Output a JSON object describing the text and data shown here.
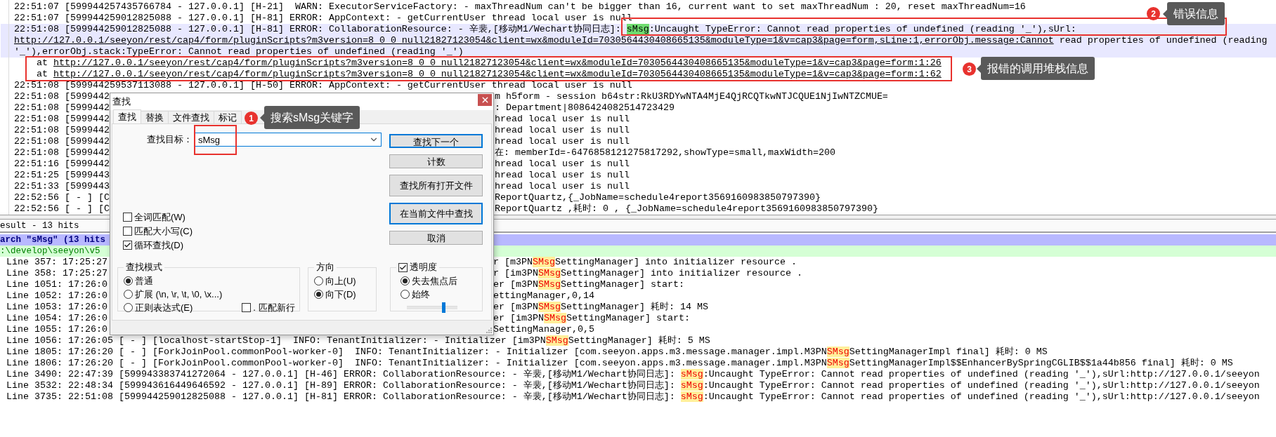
{
  "log": {
    "lines": [
      {
        "current": false,
        "left": [
          {
            "kind": "text",
            "text": "22:51:07 [599944257435766784 - 127.0.0.1] [H-21]  WARN: ExecutorServiceFactory: - maxThreadNum can't be bigger than 16, current want to set maxThreadNum : 20, reset maxThreadNum=16"
          }
        ]
      },
      {
        "current": false,
        "left": [
          {
            "kind": "text",
            "text": "22:51:07 [599944259012825088 - 127.0.0.1] [H-81] ERROR: AppContext: - getCurrentUser thread local user is null"
          }
        ]
      },
      {
        "current": true,
        "left": [
          {
            "kind": "text",
            "text": "22:51:08 [599944259012825088 - 127.0.0.1] [H-81] ERROR: CollaborationResource: - 辛裴,[移动M1/Wechart协同日志]: "
          },
          {
            "kind": "mark",
            "text": "sMsg"
          },
          {
            "kind": "text",
            "text": ":Uncaught TypeError: Cannot read properties of undefined (reading '_'),sUrl:"
          }
        ]
      },
      {
        "current": true,
        "left": [
          {
            "kind": "link",
            "text": "http://127.0.0.1/seeyon/rest/cap4/form/pluginScripts?m3version=8_0_0_null21827123054&client=wx&moduleId=7030564430408665135&moduleType=1&v=cap3&page=form,sLine:1,errorObj.message:Cannot"
          },
          {
            "kind": "text",
            "text": " read properties of undefined (reading"
          }
        ]
      },
      {
        "current": true,
        "left": [
          {
            "kind": "text",
            "text": "'_'),errorObj.stack:TypeError: Cannot read properties of undefined (reading '_')"
          }
        ]
      },
      {
        "current": false,
        "left": [
          {
            "kind": "text",
            "text": "    at "
          },
          {
            "kind": "link",
            "text": "http://127.0.0.1/seeyon/rest/cap4/form/pluginScripts?m3version=8_0_0_null21827123054&client=wx&moduleId=7030564430408665135&moduleType=1&v=cap3&page=form:1:26"
          }
        ]
      },
      {
        "current": false,
        "left": [
          {
            "kind": "text",
            "text": "    at "
          },
          {
            "kind": "link",
            "text": "http://127.0.0.1/seeyon/rest/cap4/form/pluginScripts?m3version=8_0_0_null21827123054&client=wx&moduleId=7030564430408665135&moduleType=1&v=cap3&page=form:1:62"
          }
        ]
      },
      {
        "current": false,
        "left": [
          {
            "kind": "text",
            "text": "22:51:08 [599944259537113088 - 127.0.0.1] [H-50] ERROR: AppContext: - getCurrentUser thread local user is null"
          }
        ]
      },
      {
        "current": false,
        "left": [
          {
            "kind": "text",
            "text": "22:51:08 [5999442"
          }
        ],
        "right": [
          {
            "kind": "text",
            "text": "m h5form - session b64str:RkU3RDYwNTA4MjE4QjRCQTkwNTJCQUE1NjIwNTZCMUE="
          }
        ]
      },
      {
        "current": false,
        "left": [
          {
            "kind": "text",
            "text": "22:51:08 [5999442"
          }
        ],
        "right": [
          {
            "kind": "text",
            "text": ": Department|8086424082514723429"
          }
        ]
      },
      {
        "current": false,
        "left": [
          {
            "kind": "text",
            "text": "22:51:08 [5999442"
          }
        ],
        "right": [
          {
            "kind": "text",
            "text": "hread local user is null"
          }
        ]
      },
      {
        "current": false,
        "left": [
          {
            "kind": "text",
            "text": "22:51:08 [5999442"
          }
        ],
        "right": [
          {
            "kind": "text",
            "text": "hread local user is null"
          }
        ]
      },
      {
        "current": false,
        "left": [
          {
            "kind": "text",
            "text": "22:51:08 [5999442"
          }
        ],
        "right": [
          {
            "kind": "text",
            "text": "hread local user is null"
          }
        ]
      },
      {
        "current": false,
        "left": [
          {
            "kind": "text",
            "text": "22:51:08 [5999442"
          }
        ],
        "right": [
          {
            "kind": "text",
            "text": "在: memberId=-6476858121275817292,showType=small,maxWidth=200"
          }
        ]
      },
      {
        "current": false,
        "left": [
          {
            "kind": "text",
            "text": "22:51:16 [5999442"
          }
        ],
        "right": [
          {
            "kind": "text",
            "text": "hread local user is null"
          }
        ]
      },
      {
        "current": false,
        "left": [
          {
            "kind": "text",
            "text": "22:51:25 [5999443"
          }
        ],
        "right": [
          {
            "kind": "text",
            "text": "hread local user is null"
          }
        ]
      },
      {
        "current": false,
        "left": [
          {
            "kind": "text",
            "text": "22:51:33 [5999443"
          }
        ],
        "right": [
          {
            "kind": "text",
            "text": "hread local user is null"
          }
        ]
      },
      {
        "current": false,
        "left": [
          {
            "kind": "text",
            "text": "22:52:56 [ - ] [C"
          }
        ],
        "right": [
          {
            "kind": "text",
            "text": "ReportQuartz,{_JobName=schedule4report3569160983850797390}"
          }
        ]
      },
      {
        "current": false,
        "left": [
          {
            "kind": "text",
            "text": "22:52:56 [ - ] [C"
          }
        ],
        "right": [
          {
            "kind": "text",
            "text": "ReportQuartz ,耗时: 0 , {_JobName=schedule4report3569160983850797390}"
          }
        ]
      }
    ]
  },
  "results": {
    "title": "esult - 13 hits",
    "search": "arch \"sMsg\" (13 hits",
    "file": ":\\develop\\seeyon\\v5",
    "lines": [
      {
        "left": [
          {
            "kind": "text",
            "text": "Line 357: 17:25:27"
          }
        ],
        "right": [
          {
            "kind": "text",
            "text": "r [m3PN"
          },
          {
            "kind": "hit",
            "text": "SMsg"
          },
          {
            "kind": "text",
            "text": "SettingManager] into initializer resource ."
          }
        ]
      },
      {
        "left": [
          {
            "kind": "text",
            "text": "Line 358: 17:25:27"
          }
        ],
        "right": [
          {
            "kind": "text",
            "text": "r [im3PN"
          },
          {
            "kind": "hit",
            "text": "SMsg"
          },
          {
            "kind": "text",
            "text": "SettingManager] into initializer resource ."
          }
        ]
      },
      {
        "left": [
          {
            "kind": "text",
            "text": "Line 1051: 17:26:0"
          }
        ],
        "right": [
          {
            "kind": "text",
            "text": "er [m3PN"
          },
          {
            "kind": "hit",
            "text": "SMsg"
          },
          {
            "kind": "text",
            "text": "SettingManager] start:"
          }
        ]
      },
      {
        "left": [
          {
            "kind": "text",
            "text": "Line 1052: 17:26:0"
          }
        ],
        "right": [
          {
            "kind": "text",
            "text": "ettingManager,0,14"
          }
        ]
      },
      {
        "left": [
          {
            "kind": "text",
            "text": "Line 1053: 17:26:0"
          }
        ],
        "right": [
          {
            "kind": "text",
            "text": "er [m3PN"
          },
          {
            "kind": "hit",
            "text": "SMsg"
          },
          {
            "kind": "text",
            "text": "SettingManager] 耗时: 14 MS"
          }
        ]
      },
      {
        "left": [
          {
            "kind": "text",
            "text": "Line 1054: 17:26:0"
          }
        ],
        "right": [
          {
            "kind": "text",
            "text": "er [im3PN"
          },
          {
            "kind": "hit",
            "text": "SMsg"
          },
          {
            "kind": "text",
            "text": "SettingManager] start:"
          }
        ]
      },
      {
        "left": [
          {
            "kind": "text",
            "text": "Line 1055: 17:26:0"
          }
        ],
        "right": [
          {
            "kind": "text",
            "text": "SettingManager,0,5"
          }
        ]
      },
      {
        "left": [
          {
            "kind": "text",
            "text": "Line 1056: 17:26:05 [ - ] [localhost-startStop-1]  INFO: TenantInitializer: - Initializer [im3PN"
          },
          {
            "kind": "hit",
            "text": "SMsg"
          },
          {
            "kind": "text",
            "text": "SettingManager] 耗时: 5 MS"
          }
        ]
      },
      {
        "left": [
          {
            "kind": "text",
            "text": "Line 1805: 17:26:20 [ - ] [ForkJoinPool.commonPool-worker-0]  INFO: TenantInitializer: - Initializer [com.seeyon.apps.m3.message.manager.impl.M3PN"
          },
          {
            "kind": "hit",
            "text": "SMsg"
          },
          {
            "kind": "text",
            "text": "SettingManagerImpl final] 耗时: 0 MS"
          }
        ]
      },
      {
        "left": [
          {
            "kind": "text",
            "text": "Line 1806: 17:26:20 [ - ] [ForkJoinPool.commonPool-worker-0]  INFO: TenantInitializer: - Initializer [com.seeyon.apps.m3.message.manager.impl.M3PN"
          },
          {
            "kind": "hit",
            "text": "SMsg"
          },
          {
            "kind": "text",
            "text": "SettingManagerImpl$$EnhancerBySpringCGLIB$$1a44b856 final] 耗时: 0 MS"
          }
        ]
      },
      {
        "left": [
          {
            "kind": "text",
            "text": "Line 3490: 22:47:39 [599943383741272064 - 127.0.0.1] [H-46] ERROR: CollaborationResource: - 辛裴,[移动M1/Wechart协同日志]: "
          },
          {
            "kind": "hit",
            "text": "sMsg"
          },
          {
            "kind": "text",
            "text": ":Uncaught TypeError: Cannot read properties of undefined (reading '_'),sUrl:http://127.0.0.1/seeyon"
          }
        ]
      },
      {
        "left": [
          {
            "kind": "text",
            "text": "Line 3532: 22:48:34 [599943616449646592 - 127.0.0.1] [H-89] ERROR: CollaborationResource: - 辛裴,[移动M1/Wechart协同日志]: "
          },
          {
            "kind": "hit",
            "text": "sMsg"
          },
          {
            "kind": "text",
            "text": ":Uncaught TypeError: Cannot read properties of undefined (reading '_'),sUrl:http://127.0.0.1/seeyon"
          }
        ]
      },
      {
        "left": [
          {
            "kind": "text",
            "text": "Line 3735: 22:51:08 [599944259012825088 - 127.0.0.1] [H-81] ERROR: CollaborationResource: - 辛裴,[移动M1/Wechart协同日志]: "
          },
          {
            "kind": "hit",
            "text": "sMsg"
          },
          {
            "kind": "text",
            "text": ":Uncaught TypeError: Cannot read properties of undefined (reading '_'),sUrl:http://127.0.0.1/seeyon"
          }
        ]
      }
    ]
  },
  "dialog": {
    "title": "查找",
    "tabs": [
      {
        "label": "查找",
        "selected": true
      },
      {
        "label": "替换",
        "selected": false
      },
      {
        "label": "文件查找",
        "selected": false
      },
      {
        "label": "标记",
        "selected": false
      }
    ],
    "field_label": "查找目标：",
    "search_value": "sMsg",
    "buttons": [
      {
        "label": "查找下一个",
        "focused": true
      },
      {
        "label": "计数",
        "focused": false
      },
      {
        "label": "查找所有打开文件",
        "focused": false
      },
      {
        "label": "在当前文件中查找",
        "focused": true
      },
      {
        "label": "取消",
        "focused": false
      }
    ],
    "options": [
      {
        "label": "全词匹配(W)",
        "checked": false
      },
      {
        "label": "匹配大小写(C)",
        "checked": false
      },
      {
        "label": "循环查找(D)",
        "checked": true
      }
    ],
    "mode": {
      "title": "查找模式",
      "choices": [
        {
          "label": "普通",
          "selected": true
        },
        {
          "label": "扩展 (\\n, \\r, \\t, \\0, \\x...)",
          "selected": false
        },
        {
          "label": "正则表达式(E)",
          "selected": false
        }
      ],
      "newline": {
        "label": ". 匹配新行",
        "checked": false
      }
    },
    "direction": {
      "title": "方向",
      "choices": [
        {
          "label": "向上(U)",
          "selected": false
        },
        {
          "label": "向下(D)",
          "selected": true
        }
      ]
    },
    "transparency": {
      "label": "透明度",
      "checked": true,
      "choices": [
        {
          "label": "失去焦点后",
          "selected": true
        },
        {
          "label": "始终",
          "selected": false
        }
      ],
      "level": 0.71
    }
  },
  "annotations": [
    {
      "number": "1",
      "label": "搜索sMsg关键字"
    },
    {
      "number": "2",
      "label": "错误信息"
    },
    {
      "number": "3",
      "label": "报错的调用堆栈信息"
    }
  ]
}
